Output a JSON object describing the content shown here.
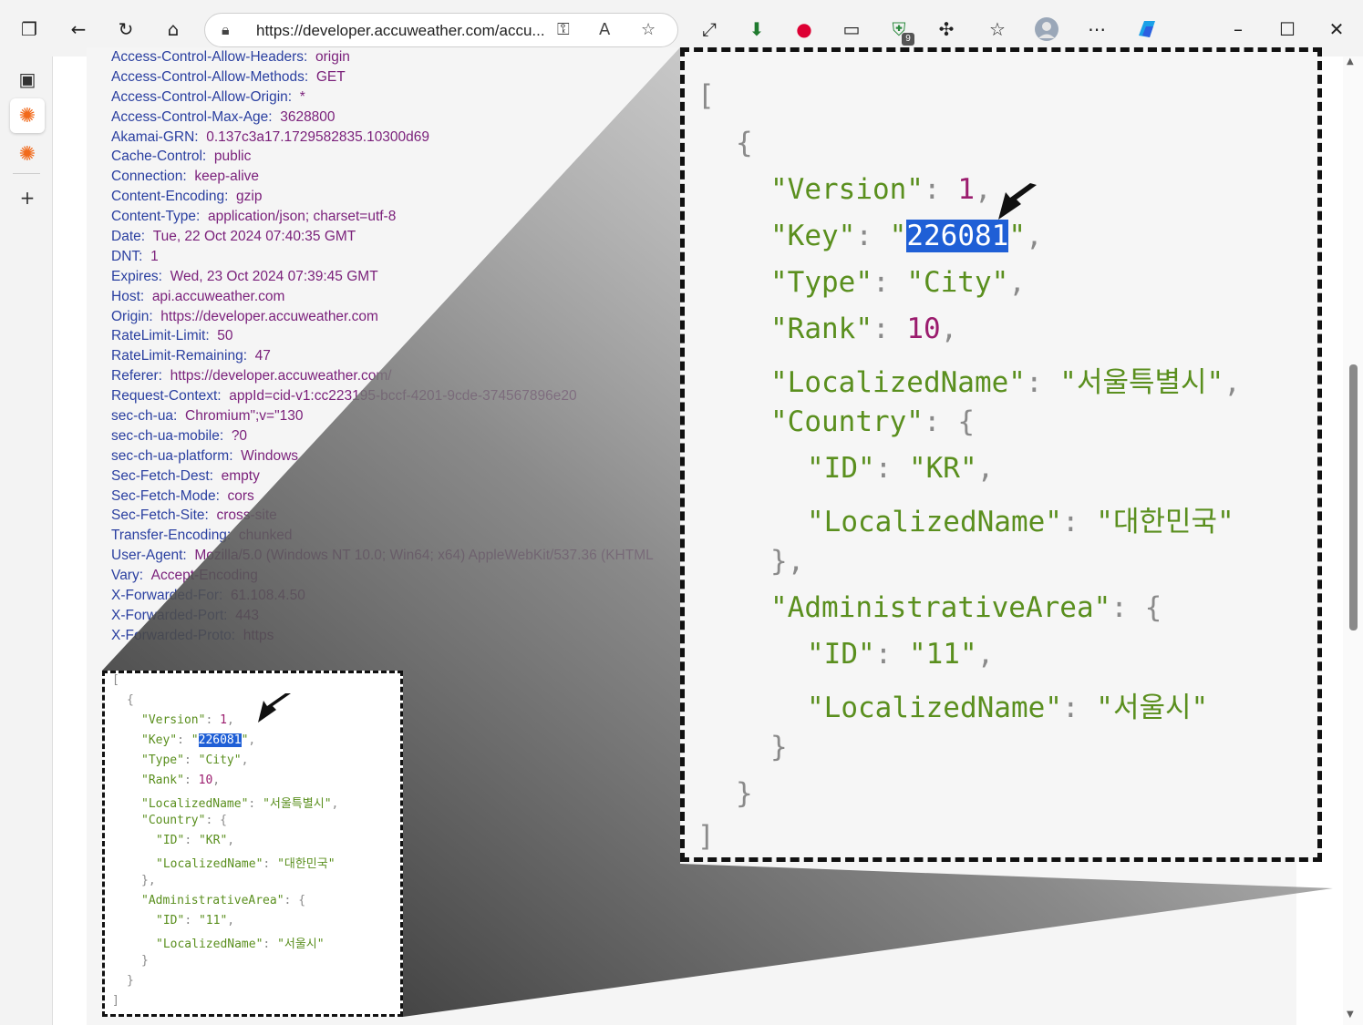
{
  "browser": {
    "url": "https://developer.accuweather.com/accu...",
    "extension_badge": "9"
  },
  "response_headers": [
    {
      "name": "Access-Control-Allow-Headers:",
      "value": "origin"
    },
    {
      "name": "Access-Control-Allow-Methods:",
      "value": "GET"
    },
    {
      "name": "Access-Control-Allow-Origin:",
      "value": "*"
    },
    {
      "name": "Access-Control-Max-Age:",
      "value": "3628800"
    },
    {
      "name": "Akamai-GRN:",
      "value": "0.137c3a17.1729582835.10300d69"
    },
    {
      "name": "Cache-Control:",
      "value": "public"
    },
    {
      "name": "Connection:",
      "value": "keep-alive"
    },
    {
      "name": "Content-Encoding:",
      "value": "gzip"
    },
    {
      "name": "Content-Type:",
      "value": "application/json; charset=utf-8"
    },
    {
      "name": "Date:",
      "value": "Tue, 22 Oct 2024 07:40:35 GMT"
    },
    {
      "name": "DNT:",
      "value": "1"
    },
    {
      "name": "Expires:",
      "value": "Wed, 23 Oct 2024 07:39:45 GMT"
    },
    {
      "name": "Host:",
      "value": "api.accuweather.com"
    },
    {
      "name": "Origin:",
      "value": "https://developer.accuweather.com"
    },
    {
      "name": "RateLimit-Limit:",
      "value": "50"
    },
    {
      "name": "RateLimit-Remaining:",
      "value": "47"
    },
    {
      "name": "Referer:",
      "value": "https://developer.accuweather.com/"
    },
    {
      "name": "Request-Context:",
      "value": "appId=cid-v1:cc223195-bccf-4201-9cde-374567896e20"
    },
    {
      "name": "sec-ch-ua:",
      "value": "Chromium\";v=\"130"
    },
    {
      "name": "sec-ch-ua-mobile:",
      "value": "?0"
    },
    {
      "name": "sec-ch-ua-platform:",
      "value": "Windows"
    },
    {
      "name": "Sec-Fetch-Dest:",
      "value": "empty"
    },
    {
      "name": "Sec-Fetch-Mode:",
      "value": "cors"
    },
    {
      "name": "Sec-Fetch-Site:",
      "value": "cross-site"
    },
    {
      "name": "Transfer-Encoding:",
      "value": "chunked"
    },
    {
      "name": "User-Agent:",
      "value": "Mozilla/5.0 (Windows NT 10.0; Win64; x64) AppleWebKit/537.36 (KHTML"
    },
    {
      "name": "Vary:",
      "value": "Accept-Encoding"
    },
    {
      "name": "X-Forwarded-For:",
      "value": "61.108.4.50"
    },
    {
      "name": "X-Forwarded-Port:",
      "value": "443"
    },
    {
      "name": "X-Forwarded-Proto:",
      "value": "https"
    }
  ],
  "json_response": {
    "open_bracket": "[",
    "open_brace": "{",
    "version_key": "\"Version\"",
    "version_value": "1",
    "key_key": "\"Key\"",
    "key_value": "226081",
    "type_key": "\"Type\"",
    "type_value": "\"City\"",
    "rank_key": "\"Rank\"",
    "rank_value": "10",
    "localized_name_key": "\"LocalizedName\"",
    "localized_name_value": "\"서울특별시\"",
    "country_key": "\"Country\"",
    "country_id_key": "\"ID\"",
    "country_id_value": "\"KR\"",
    "country_name_key": "\"LocalizedName\"",
    "country_name_value": "\"대한민국\"",
    "admin_key": "\"AdministrativeArea\"",
    "admin_id_key": "\"ID\"",
    "admin_id_value": "\"11\"",
    "admin_name_key": "\"LocalizedName\"",
    "admin_name_value": "\"서울시\"",
    "close_brace": "}",
    "close_bracket": "]"
  },
  "colors": {
    "header_name": "#2a3fa0",
    "header_value": "#7a1f7a",
    "json_key": "#5a8f1e",
    "json_number": "#9b1c6e",
    "selection": "#1f5fd6"
  }
}
